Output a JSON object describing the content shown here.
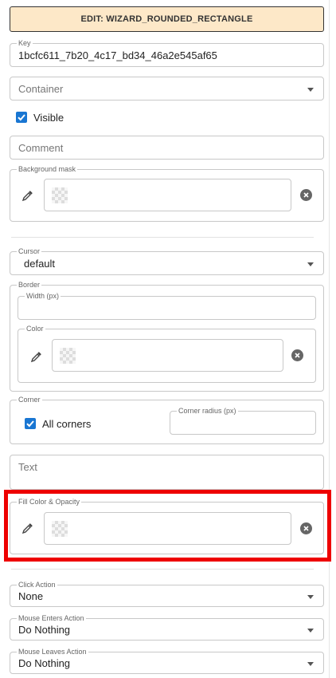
{
  "header": {
    "title": "EDIT: WIZARD_ROUNDED_RECTANGLE"
  },
  "key": {
    "label": "Key",
    "value": "1bcfc611_7b20_4c17_bd34_46a2e545af65"
  },
  "container": {
    "placeholder": "Container"
  },
  "visible": {
    "label": "Visible",
    "checked": true
  },
  "comment": {
    "placeholder": "Comment"
  },
  "background_mask": {
    "label": "Background mask"
  },
  "cursor": {
    "label": "Cursor",
    "value": "default"
  },
  "border": {
    "label": "Border",
    "width": {
      "label": "Width (px)",
      "value": ""
    },
    "color": {
      "label": "Color"
    }
  },
  "corner": {
    "label": "Corner",
    "all_corners": {
      "label": "All corners",
      "checked": true
    },
    "radius": {
      "label": "Corner radius (px)",
      "value": ""
    }
  },
  "text": {
    "placeholder": "Text"
  },
  "fill": {
    "label": "Fill Color & Opacity"
  },
  "click_action": {
    "label": "Click Action",
    "value": "None"
  },
  "mouse_enters": {
    "label": "Mouse Enters Action",
    "value": "Do Nothing"
  },
  "mouse_leaves": {
    "label": "Mouse Leaves Action",
    "value": "Do Nothing"
  },
  "colors": {
    "accent": "#1976d2",
    "header_bg": "#fde8c8",
    "highlight": "#ee0000"
  }
}
